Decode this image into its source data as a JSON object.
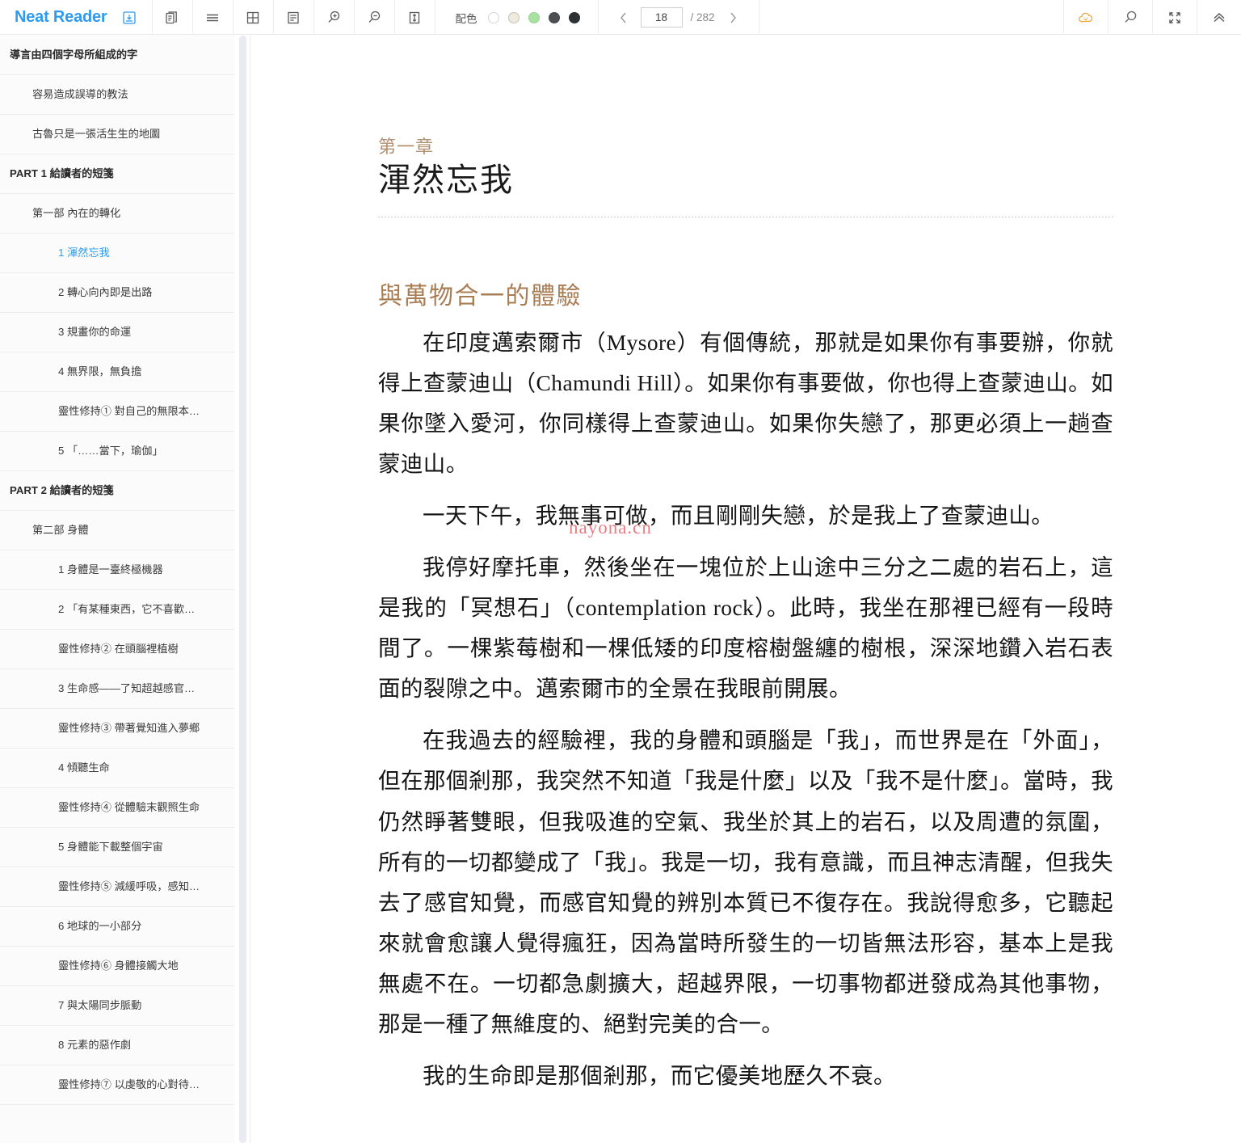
{
  "app": {
    "brand": "Neat Reader"
  },
  "toolbar": {
    "icons": [
      {
        "name": "save-icon",
        "title": "save"
      },
      {
        "name": "copy-icon",
        "title": "copy"
      },
      {
        "name": "contents-icon",
        "title": "contents"
      },
      {
        "name": "grid-layout-icon",
        "title": "grid layout"
      },
      {
        "name": "single-layout-icon",
        "title": "single layout"
      },
      {
        "name": "zoom-in-icon",
        "title": "zoom in"
      },
      {
        "name": "zoom-out-icon",
        "title": "zoom out"
      },
      {
        "name": "fit-height-icon",
        "title": "fit height"
      }
    ],
    "scheme_label": "配色",
    "scheme_colors": [
      "#ffffff",
      "#efeade",
      "#a7e2a3",
      "#4c4f52",
      "#2e3133"
    ],
    "scheme_selected_index": 0,
    "pager": {
      "prev_label": "‹",
      "next_label": "›",
      "current_page": "18",
      "total_label": "/ 282"
    },
    "right_icons": [
      {
        "name": "cloud-sync-icon",
        "color": "#f0a33c"
      },
      {
        "name": "search-icon",
        "color": "#6b6b6b"
      },
      {
        "name": "fullscreen-icon",
        "color": "#6b6b6b"
      },
      {
        "name": "collapse-toolbar-icon",
        "color": "#6b6b6b"
      }
    ]
  },
  "sidebar": {
    "items": [
      {
        "label": "導言由四個字母所組成的字",
        "level": 0,
        "active": false
      },
      {
        "label": "容易造成誤導的教法",
        "level": 1,
        "active": false
      },
      {
        "label": "古魯只是一張活生生的地圖",
        "level": 1,
        "active": false
      },
      {
        "label": "PART 1 給讀者的短箋",
        "level": 0,
        "active": false
      },
      {
        "label": "第一部 內在的轉化",
        "level": 1,
        "active": false
      },
      {
        "label": "1 渾然忘我",
        "level": 2,
        "active": true
      },
      {
        "label": "2 轉心向內即是出路",
        "level": 2,
        "active": false
      },
      {
        "label": "3 規畫你的命運",
        "level": 2,
        "active": false
      },
      {
        "label": "4 無界限，無負擔",
        "level": 2,
        "active": false
      },
      {
        "label": "靈性修持① 對自己的無限本…",
        "level": 2,
        "active": false
      },
      {
        "label": "5 「……當下，瑜伽」",
        "level": 2,
        "active": false
      },
      {
        "label": "PART 2 給讀者的短箋",
        "level": 0,
        "active": false
      },
      {
        "label": "第二部 身體",
        "level": 1,
        "active": false
      },
      {
        "label": "1 身體是一臺終極機器",
        "level": 2,
        "active": false
      },
      {
        "label": "2 「有某種東西，它不喜歡…",
        "level": 2,
        "active": false
      },
      {
        "label": "靈性修持② 在頭腦裡植樹",
        "level": 2,
        "active": false
      },
      {
        "label": "3 生命感——了知超越感官…",
        "level": 2,
        "active": false
      },
      {
        "label": "靈性修持③ 帶著覺知進入夢鄉",
        "level": 2,
        "active": false
      },
      {
        "label": "4 傾聽生命",
        "level": 2,
        "active": false
      },
      {
        "label": "靈性修持④ 從體驗末觀照生命",
        "level": 2,
        "active": false
      },
      {
        "label": "5 身體能下載整個宇宙",
        "level": 2,
        "active": false
      },
      {
        "label": "靈性修持⑤ 減緩呼吸，感知…",
        "level": 2,
        "active": false
      },
      {
        "label": "6 地球的一小部分",
        "level": 2,
        "active": false
      },
      {
        "label": "靈性修持⑥ 身體接觸大地",
        "level": 2,
        "active": false
      },
      {
        "label": "7 與太陽同步脈動",
        "level": 2,
        "active": false
      },
      {
        "label": "8 元素的惡作劇",
        "level": 2,
        "active": false
      },
      {
        "label": "靈性修持⑦ 以虔敬的心對待…",
        "level": 2,
        "active": false
      }
    ]
  },
  "content": {
    "chapter_label": "第一章",
    "chapter_title": "渾然忘我",
    "section_heading": "與萬物合一的體驗",
    "watermark": "nayona.cn",
    "paragraphs": [
      "在印度邁索爾市（Mysore）有個傳統，那就是如果你有事要辦，你就得上查蒙迪山（Chamundi Hill）。如果你有事要做，你也得上查蒙迪山。如果你墜入愛河，你同樣得上查蒙迪山。如果你失戀了，那更必須上一趟查蒙迪山。",
      "一天下午，我無事可做，而且剛剛失戀，於是我上了查蒙迪山。",
      "我停好摩托車，然後坐在一塊位於上山途中三分之二處的岩石上，這是我的「冥想石」（contemplation rock）。此時，我坐在那裡已經有一段時間了。一棵紫莓樹和一棵低矮的印度榕樹盤纏的樹根，深深地鑽入岩石表面的裂隙之中。邁索爾市的全景在我眼前開展。",
      "在我過去的經驗裡，我的身體和頭腦是「我」，而世界是在「外面」，但在那個剎那，我突然不知道「我是什麼」以及「我不是什麼」。當時，我仍然睜著雙眼，但我吸進的空氣、我坐於其上的岩石，以及周遭的氛圍，所有的一切都變成了「我」。我是一切，我有意識，而且神志清醒，但我失去了感官知覺，而感官知覺的辨別本質已不復存在。我說得愈多，它聽起來就會愈讓人覺得瘋狂，因為當時所發生的一切皆無法形容，基本上是我無處不在。一切都急劇擴大，超越界限，一切事物都迸發成為其他事物，那是一種了無維度的、絕對完美的合一。",
      "我的生命即是那個剎那，而它優美地歷久不衰。"
    ]
  }
}
